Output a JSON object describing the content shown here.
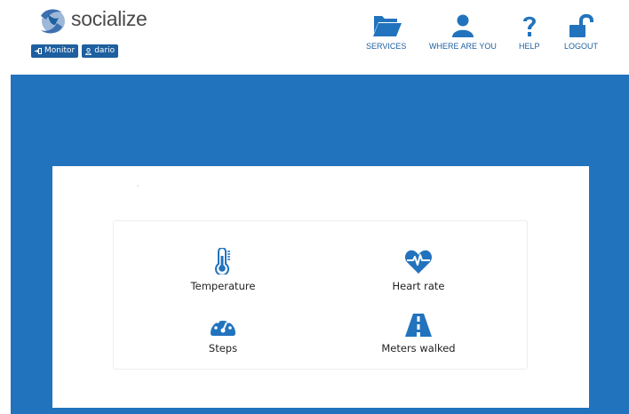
{
  "brand": {
    "name": "socialize"
  },
  "badges": [
    {
      "label": "Monitor",
      "icon": "sign-in-icon"
    },
    {
      "label": "dario",
      "icon": "user-outline-icon"
    }
  ],
  "nav": [
    {
      "label": "SERVICES",
      "icon": "folder-open-icon"
    },
    {
      "label": "WHERE ARE YOU",
      "icon": "user-icon"
    },
    {
      "label": "HELP",
      "icon": "question-icon"
    },
    {
      "label": "LOGOUT",
      "icon": "unlock-icon"
    }
  ],
  "tiles": [
    {
      "label": "Temperature",
      "icon": "thermometer-icon"
    },
    {
      "label": "Heart rate",
      "icon": "heartbeat-icon"
    },
    {
      "label": "Steps",
      "icon": "dashboard-icon"
    },
    {
      "label": "Meters walked",
      "icon": "road-icon"
    }
  ],
  "colors": {
    "primary": "#2273bd",
    "accent": "#1d5f9f",
    "text": "#222222"
  }
}
